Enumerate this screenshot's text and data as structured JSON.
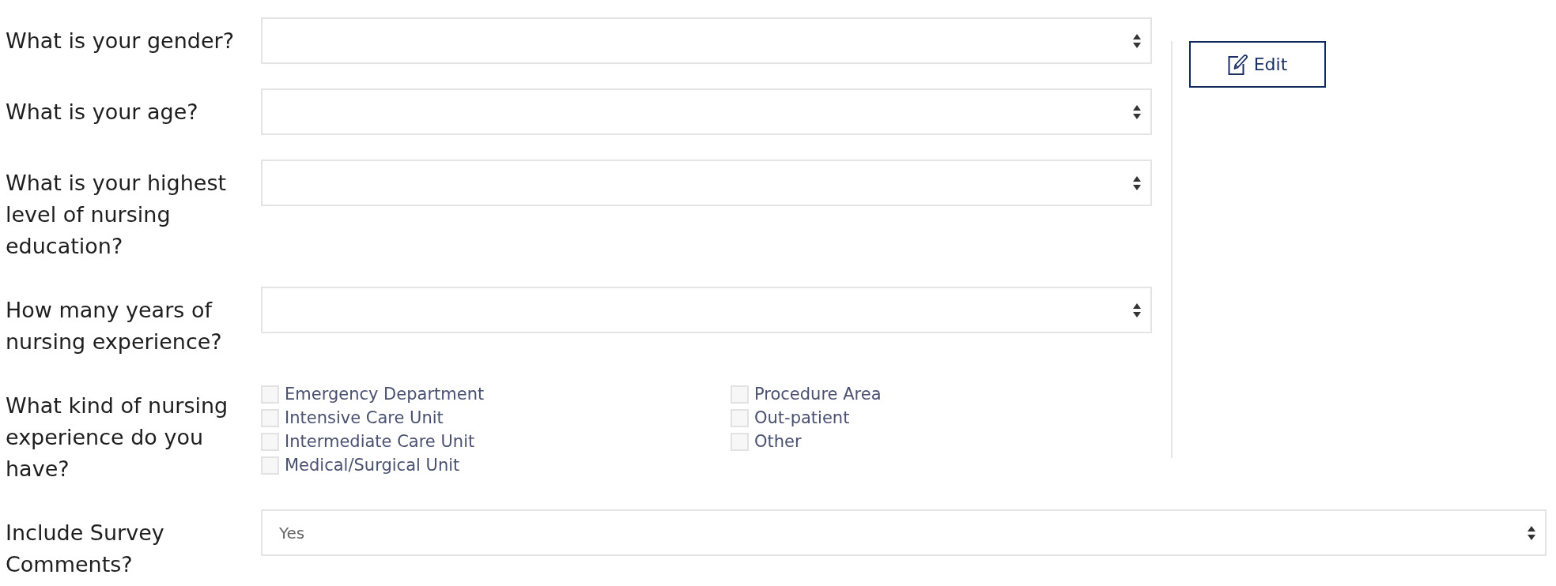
{
  "questions": [
    {
      "kind": "select",
      "label": "What is your gender?"
    },
    {
      "kind": "select",
      "label": "What is your age?"
    },
    {
      "kind": "select",
      "label": "What is your highest level of nursing education?"
    },
    {
      "kind": "select",
      "label": "How many years of nursing experience?"
    },
    {
      "kind": "checkboxes",
      "label": "What kind of nursing experience do you have?",
      "columns": [
        [
          {
            "label": "Emergency Department",
            "checked": false
          },
          {
            "label": "Intensive Care Unit",
            "checked": false
          },
          {
            "label": "Intermediate Care Unit",
            "checked": false
          },
          {
            "label": "Medical/Surgical Unit",
            "checked": false
          }
        ],
        [
          {
            "label": "Procedure Area",
            "checked": false
          },
          {
            "label": "Out-patient",
            "checked": false
          },
          {
            "label": "Other",
            "checked": false
          }
        ]
      ]
    }
  ],
  "edit_button": {
    "label": "Edit"
  },
  "survey_comments": {
    "kind": "select",
    "label": "Include Survey Comments?",
    "value": "Yes"
  }
}
